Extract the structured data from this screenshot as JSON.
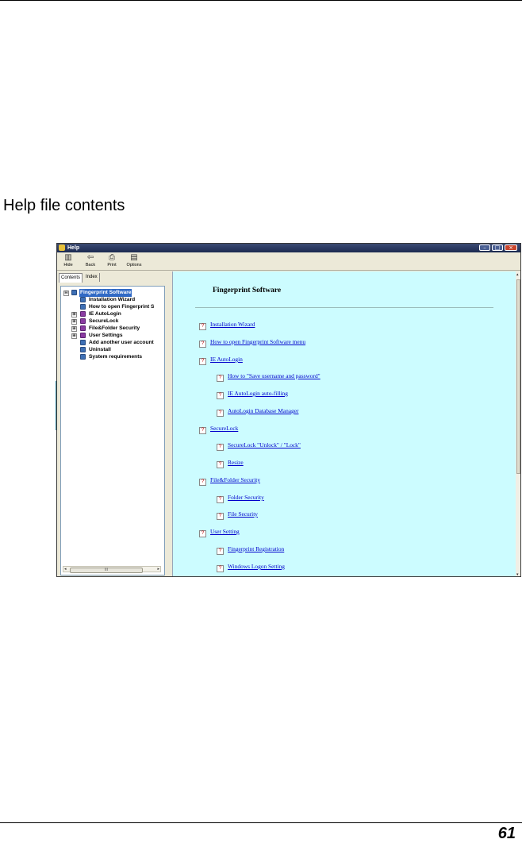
{
  "caption": "Help file contents",
  "page_number": "61",
  "window": {
    "title": "Help",
    "controls": {
      "minimize": "–",
      "maximize": "□",
      "close": "×"
    },
    "toolbar": [
      {
        "label": "Hide",
        "icon": "hide-icon",
        "glyph": "▥"
      },
      {
        "label": "Back",
        "icon": "back-icon",
        "glyph": "⇦"
      },
      {
        "label": "Print",
        "icon": "print-icon",
        "glyph": "⎙"
      },
      {
        "label": "Options",
        "icon": "options-icon",
        "glyph": "▤"
      }
    ],
    "tabs": {
      "contents": "Contents",
      "index": "Index"
    },
    "tree": [
      {
        "label": "Fingerprint Software",
        "expander": "⊟",
        "selected": true
      },
      {
        "label": "Installation Wizard"
      },
      {
        "label": "How to open Fingerprint S"
      },
      {
        "label": "IE AutoLogin",
        "expander": "⊞"
      },
      {
        "label": "SecureLock",
        "expander": "⊞"
      },
      {
        "label": "File&Folder Security",
        "expander": "⊞"
      },
      {
        "label": "User Settings",
        "expander": "⊞"
      },
      {
        "label": "Add another user account"
      },
      {
        "label": "Uninstall"
      },
      {
        "label": "System requirements"
      }
    ],
    "hscroll": {
      "thumb": "III",
      "left": "◂",
      "right": "▸"
    },
    "vscroll": {
      "up": "▴",
      "down": "▾"
    },
    "content": {
      "heading": "Fingerprint Software",
      "links": [
        {
          "label": "Installation Wizard",
          "level": 0
        },
        {
          "label": "How to open Fingerprint Software menu ",
          "level": 0
        },
        {
          "label": "IE AutoLogin",
          "level": 0
        },
        {
          "label": "How to \"Save username and password\"",
          "level": 1
        },
        {
          "label": "IE AutoLogin auto-filling",
          "level": 1
        },
        {
          "label": "AutoLogin Database Manager",
          "level": 1
        },
        {
          "label": "SecureLock",
          "level": 0
        },
        {
          "label": "SecureLock \"Unlock\" / \"Lock\"",
          "level": 1
        },
        {
          "label": "Resize",
          "level": 1
        },
        {
          "label": "File&Folder Security",
          "level": 0
        },
        {
          "label": "Folder Security",
          "level": 1
        },
        {
          "label": "File Security",
          "level": 1
        },
        {
          "label": "User Setting",
          "level": 0
        },
        {
          "label": "Fingerprint Registration",
          "level": 1
        },
        {
          "label": "Windows Logon Setting",
          "level": 1
        }
      ]
    }
  }
}
